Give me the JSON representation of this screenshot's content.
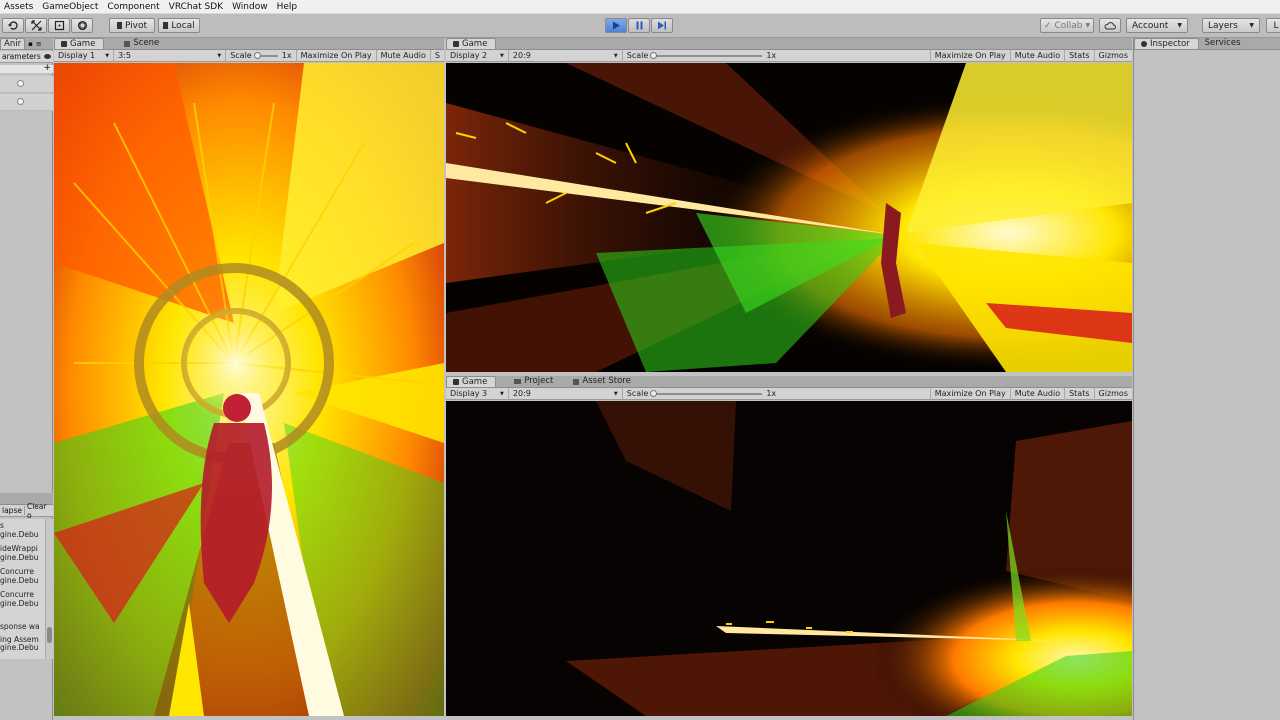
{
  "menu": [
    "Assets",
    "GameObject",
    "Component",
    "VRChat SDK",
    "Window",
    "Help"
  ],
  "toolbar": {
    "pivot_label": "Pivot",
    "local_label": "Local",
    "collab_label": "Collab",
    "account_label": "Account",
    "layers_label": "Layers"
  },
  "left_panel": {
    "tab_label": "Anir",
    "parameters_label": "arameters",
    "console_buttons": [
      "lapse",
      "Clear o"
    ],
    "console_lines": [
      "s",
      "gine.Debu",
      "ideWrappi",
      "gine.Debu",
      "Concurre",
      "gine.Debu",
      "Concurre",
      "gine.Debu",
      "sponse wa",
      "ing Assem",
      "gine.Debu"
    ]
  },
  "game1": {
    "tabs": [
      "Game",
      "Scene"
    ],
    "display": "Display 1",
    "aspect": "3:5",
    "scale_label": "Scale",
    "scale_value": "1x",
    "maximize": "Maximize On Play",
    "mute": "Mute Audio",
    "extra": "S"
  },
  "game2": {
    "tab": "Game",
    "display": "Display 2",
    "aspect": "20:9",
    "scale_label": "Scale",
    "scale_value": "1x",
    "maximize": "Maximize On Play",
    "mute": "Mute Audio",
    "stats": "Stats",
    "gizmos": "Gizmos"
  },
  "game3": {
    "tabs": [
      "Game",
      "Project",
      "Asset Store"
    ],
    "display": "Display 3",
    "aspect": "20:9",
    "scale_label": "Scale",
    "scale_value": "1x",
    "maximize": "Maximize On Play",
    "mute": "Mute Audio",
    "stats": "Stats",
    "gizmos": "Gizmos"
  },
  "inspector": {
    "tabs": [
      "Inspector",
      "Services"
    ]
  },
  "colors": {
    "play_active": "#4f82d6",
    "effect_yellow": "#ffe600",
    "effect_orange": "#ff6a00",
    "effect_red": "#d81a1a",
    "effect_green": "#2fd41a"
  }
}
